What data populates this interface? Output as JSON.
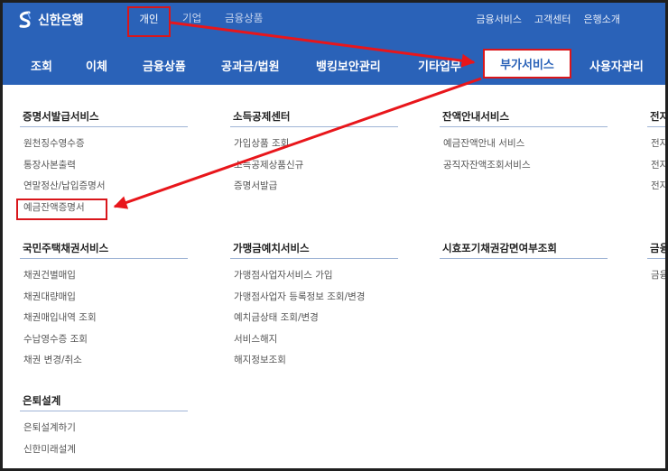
{
  "brand": {
    "name": "신한은행"
  },
  "top_nav": {
    "items": [
      "개인",
      "기업",
      "금융상품"
    ],
    "active": "개인",
    "right_links": [
      "금융서비스",
      "고객센터",
      "은행소개"
    ]
  },
  "main_nav": {
    "items": [
      "조회",
      "이체",
      "금융상품",
      "공과금/법원",
      "뱅킹보안관리",
      "기타업무",
      "부가서비스",
      "사용자관리"
    ],
    "active": "부가서비스"
  },
  "sections": [
    {
      "title": "증명서발급서비스",
      "items": [
        "원천징수영수증",
        "통장사본출력",
        "연말정산/납입증명서",
        "예금잔액증명서"
      ]
    },
    {
      "title": "소득공제센터",
      "items": [
        "가입상품 조회",
        "소득공제상품신규",
        "증명서발급"
      ]
    },
    {
      "title": "잔액안내서비스",
      "items": [
        "예금잔액안내 서비스",
        "공직자잔액조회서비스"
      ]
    },
    {
      "title": "전자",
      "items": [
        "전자",
        "전자",
        "전자"
      ]
    },
    {
      "title": "국민주택채권서비스",
      "items": [
        "채권건별매입",
        "채권대량매입",
        "채권매입내역 조회",
        "수납영수증 조회",
        "채권 변경/취소"
      ]
    },
    {
      "title": "가맹금예치서비스",
      "items": [
        "가맹점사업자서비스 가입",
        "가맹점사업자 등록정보 조회/변경",
        "예치금상태 조회/변경",
        "서비스해지",
        "해지정보조회"
      ]
    },
    {
      "title": "시효포기채권감면여부조회",
      "items": []
    },
    {
      "title": "금융",
      "items": [
        "금융"
      ]
    },
    {
      "title": "은퇴설계",
      "items": [
        "은퇴설계하기",
        "신한미래설계"
      ]
    }
  ],
  "colors": {
    "header_bg": "#2a62b8",
    "highlight_red": "#d9161b",
    "divider": "#9fb4d6"
  }
}
